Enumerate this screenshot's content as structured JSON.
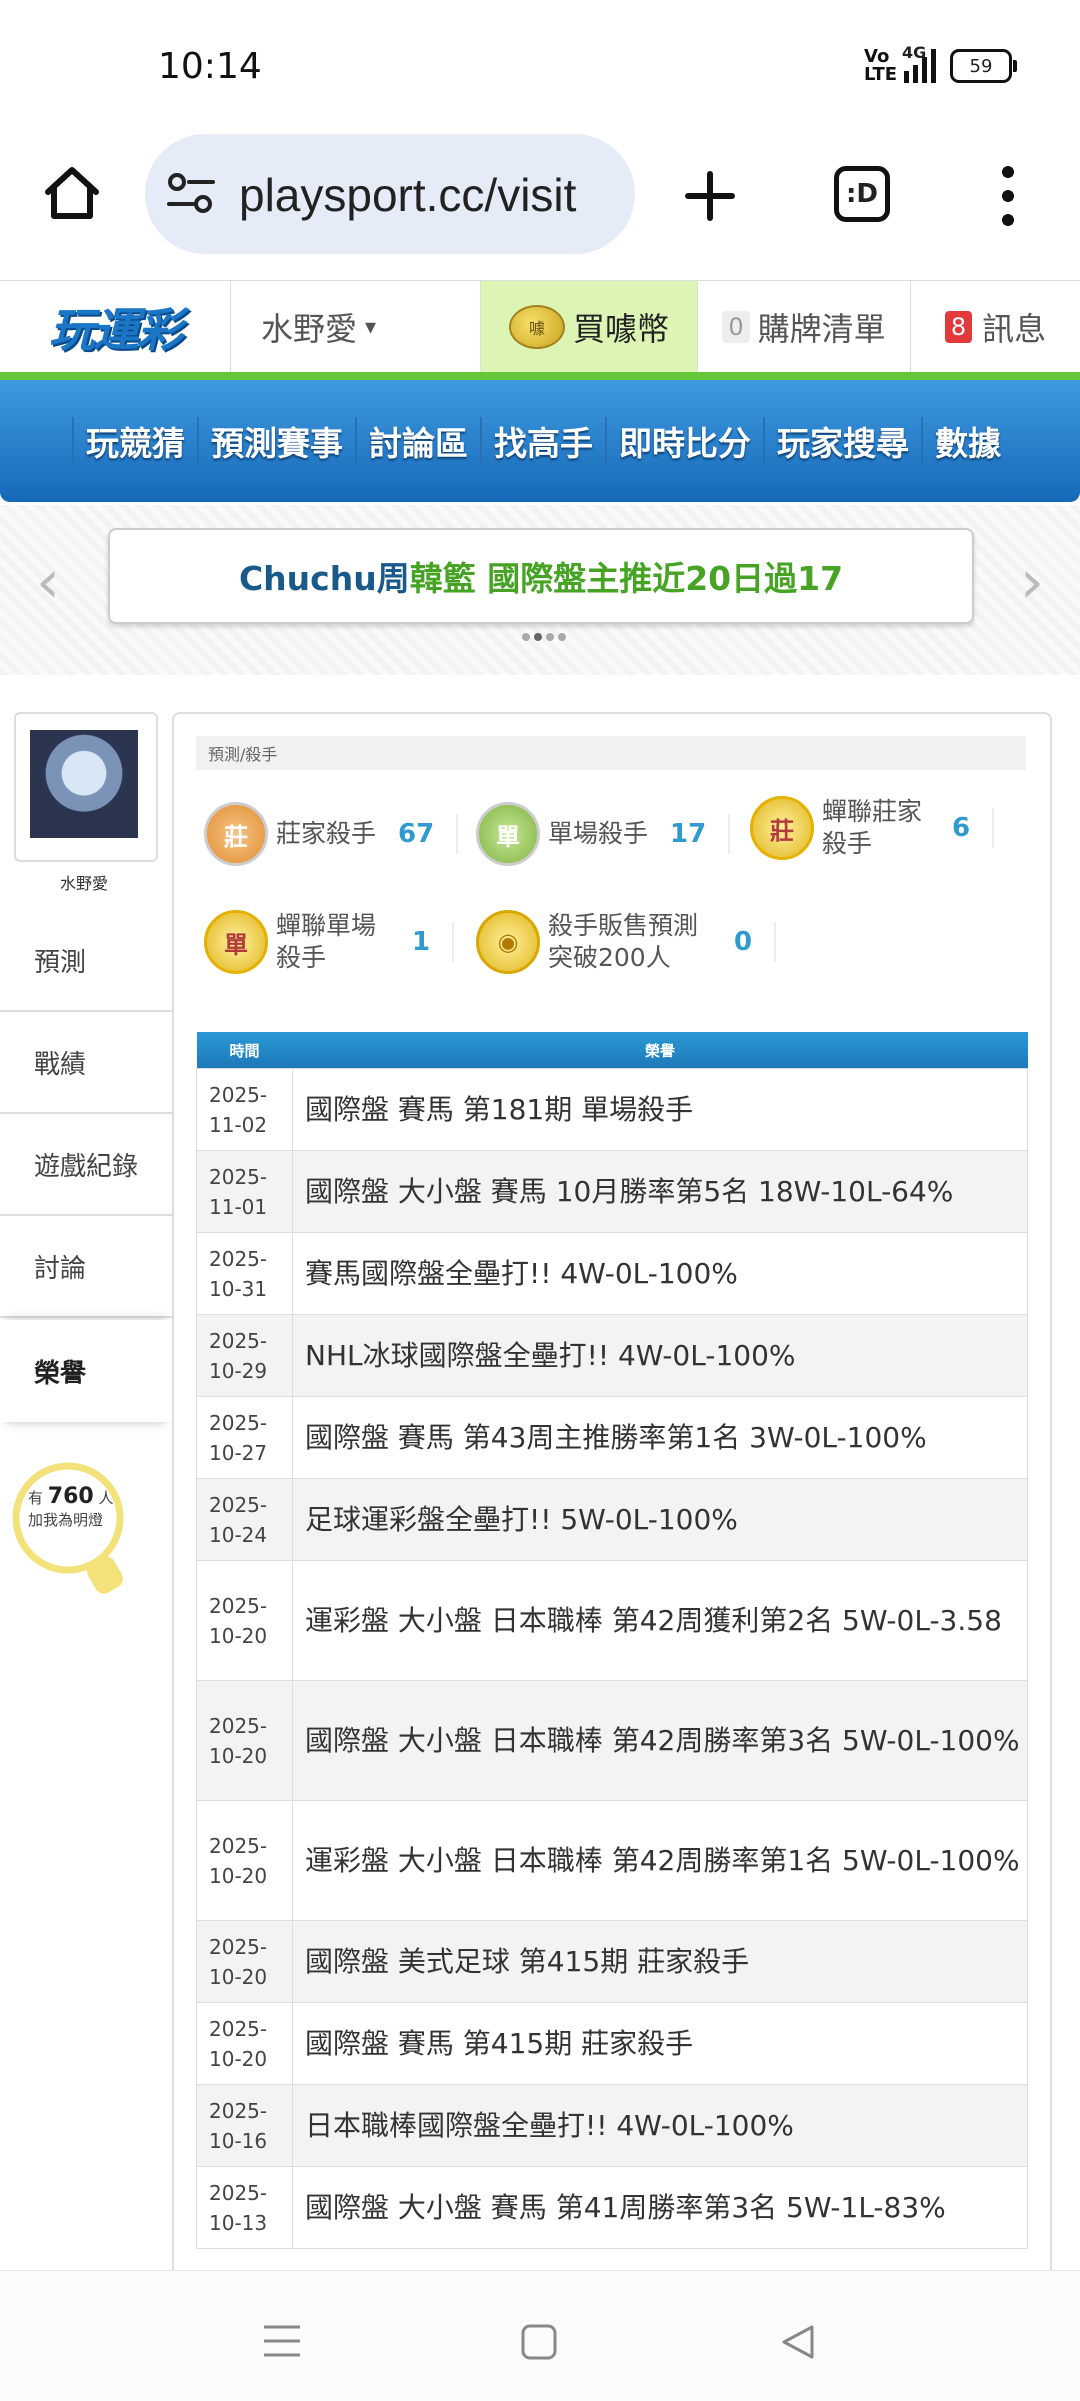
{
  "status": {
    "time": "10:14",
    "network_label": "4G",
    "volte_label": "Vo LTE",
    "battery": "59"
  },
  "browser": {
    "url": "playsport.cc/visit",
    "tabs_label": ":D"
  },
  "site": {
    "user_menu": "水野愛",
    "buy_coin": "買噱幣",
    "coin_label": "噱",
    "cart_label": "購牌清單",
    "cart_count": "0",
    "msg_label": "訊息",
    "msg_count": "8"
  },
  "nav": [
    "玩競猜",
    "預測賽事",
    "討論區",
    "找高手",
    "即時比分",
    "玩家搜尋",
    "數據"
  ],
  "banner": {
    "part1": "Chuchu周 ",
    "part2": "韓籃 國際盤主推近20日過17"
  },
  "sidebar": {
    "username": "水野愛",
    "items": [
      "預測",
      "戰績",
      "遊戲紀錄",
      "討論",
      "榮譽"
    ],
    "fans_prefix": "有",
    "fans_count": "760",
    "fans_suffix": "人",
    "fans_text": "加我為明燈"
  },
  "panel": {
    "breadcrumb": "預測/殺手",
    "stats": [
      {
        "medal": "莊",
        "label": "莊家殺手",
        "value": "67"
      },
      {
        "medal": "單",
        "label": "單場殺手",
        "value": "17"
      },
      {
        "medal": "莊",
        "label": "蟬聯莊家",
        "label2": "殺手",
        "value": "6"
      },
      {
        "medal": "單",
        "label": "蟬聯單場",
        "label2": "殺手",
        "value": "1"
      },
      {
        "medal": "",
        "label": "殺手販售預測",
        "label2": "突破200人",
        "value": "0"
      }
    ],
    "table": {
      "headers": [
        "時間",
        "榮譽"
      ],
      "rows": [
        {
          "y": "2025-",
          "md": "11-02",
          "text": "國際盤 賽馬 第181期 單場殺手"
        },
        {
          "y": "2025-",
          "md": "11-01",
          "text": "國際盤 大小盤 賽馬 10月勝率第5名 18W-10L-64%"
        },
        {
          "y": "2025-",
          "md": "10-31",
          "text": "賽馬國際盤全壘打!! 4W-0L-100%"
        },
        {
          "y": "2025-",
          "md": "10-29",
          "text": "NHL冰球國際盤全壘打!! 4W-0L-100%"
        },
        {
          "y": "2025-",
          "md": "10-27",
          "text": "國際盤 賽馬 第43周主推勝率第1名 3W-0L-100%"
        },
        {
          "y": "2025-",
          "md": "10-24",
          "text": "足球運彩盤全壘打!! 5W-0L-100%"
        },
        {
          "y": "2025-",
          "md": "10-20",
          "text": "運彩盤 大小盤 日本職棒 第42周獲利第2名 5W-0L-3.58"
        },
        {
          "y": "2025-",
          "md": "10-20",
          "text": "國際盤 大小盤 日本職棒 第42周勝率第3名 5W-0L-100%"
        },
        {
          "y": "2025-",
          "md": "10-20",
          "text": "運彩盤 大小盤 日本職棒 第42周勝率第1名 5W-0L-100%"
        },
        {
          "y": "2025-",
          "md": "10-20",
          "text": "國際盤 美式足球 第415期 莊家殺手"
        },
        {
          "y": "2025-",
          "md": "10-20",
          "text": "國際盤 賽馬 第415期 莊家殺手"
        },
        {
          "y": "2025-",
          "md": "10-16",
          "text": "日本職棒國際盤全壘打!! 4W-0L-100%"
        },
        {
          "y": "2025-",
          "md": "10-13",
          "text": "國際盤 大小盤 賽馬 第41周勝率第3名 5W-1L-83%"
        }
      ]
    }
  },
  "colors": {
    "nav_blue": "#1769b8",
    "accent_green": "#66c63a",
    "value_blue": "#2e9ad0",
    "msg_red": "#e23a3a"
  },
  "icons": [
    "home-icon",
    "site-info-icon",
    "plus-icon",
    "tabs-icon",
    "more-menu-icon",
    "menu-lines-icon",
    "square-icon",
    "back-triangle-icon",
    "lightbulb-icon"
  ]
}
